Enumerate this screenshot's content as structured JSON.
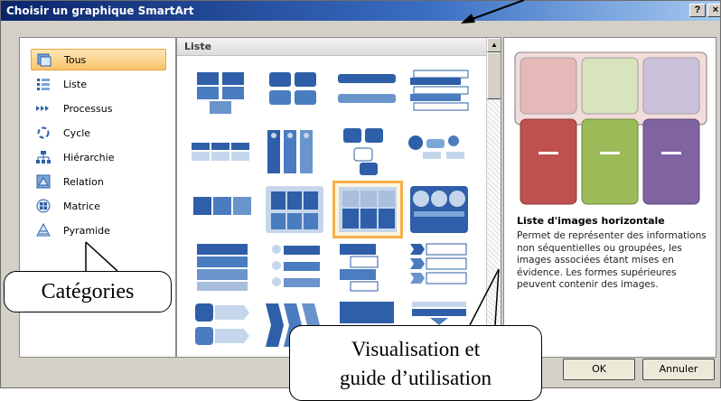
{
  "window": {
    "title": "Choisir un graphique SmartArt",
    "help_label": "?",
    "close_label": "×"
  },
  "categories": [
    {
      "label": "Tous",
      "icon": "all-icon",
      "selected": true
    },
    {
      "label": "Liste",
      "icon": "list-icon"
    },
    {
      "label": "Processus",
      "icon": "process-icon"
    },
    {
      "label": "Cycle",
      "icon": "cycle-icon"
    },
    {
      "label": "Hiérarchie",
      "icon": "hierarchy-icon"
    },
    {
      "label": "Relation",
      "icon": "relation-icon"
    },
    {
      "label": "Matrice",
      "icon": "matrix-icon"
    },
    {
      "label": "Pyramide",
      "icon": "pyramid-icon"
    }
  ],
  "gallery": {
    "header": "Liste",
    "selected_index": 10
  },
  "preview": {
    "title": "Liste d'images horizontale",
    "description": "Permet de représenter des informations non séquentielles ou groupées, les images associées étant mises en évidence. Les formes supérieures peuvent contenir des images."
  },
  "buttons": {
    "ok": "OK",
    "cancel": "Annuler"
  },
  "callouts": {
    "categories": "Catégories",
    "visualisation_line1": "Visualisation et",
    "visualisation_line2": "guide d’utilisation"
  },
  "colors": {
    "accent_blue": "#2e5fa8",
    "selected_orange": "#f5b04a",
    "red": "#c0504d",
    "green": "#9bbb59",
    "purple": "#8064a2"
  }
}
